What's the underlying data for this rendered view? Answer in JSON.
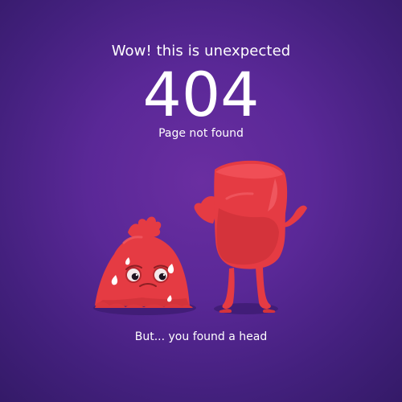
{
  "error_page": {
    "headline": "Wow! this is unexpected",
    "code": "404",
    "message": "Page not found",
    "footer": "But... you found a head"
  },
  "colors": {
    "background_center": "#6a2ea1",
    "background_edge": "#341a68",
    "character_red": "#e53b43",
    "character_shadow": "#c7282f",
    "text": "#ffffff"
  },
  "icons": [
    "sad-blob-character",
    "headless-body-character"
  ]
}
